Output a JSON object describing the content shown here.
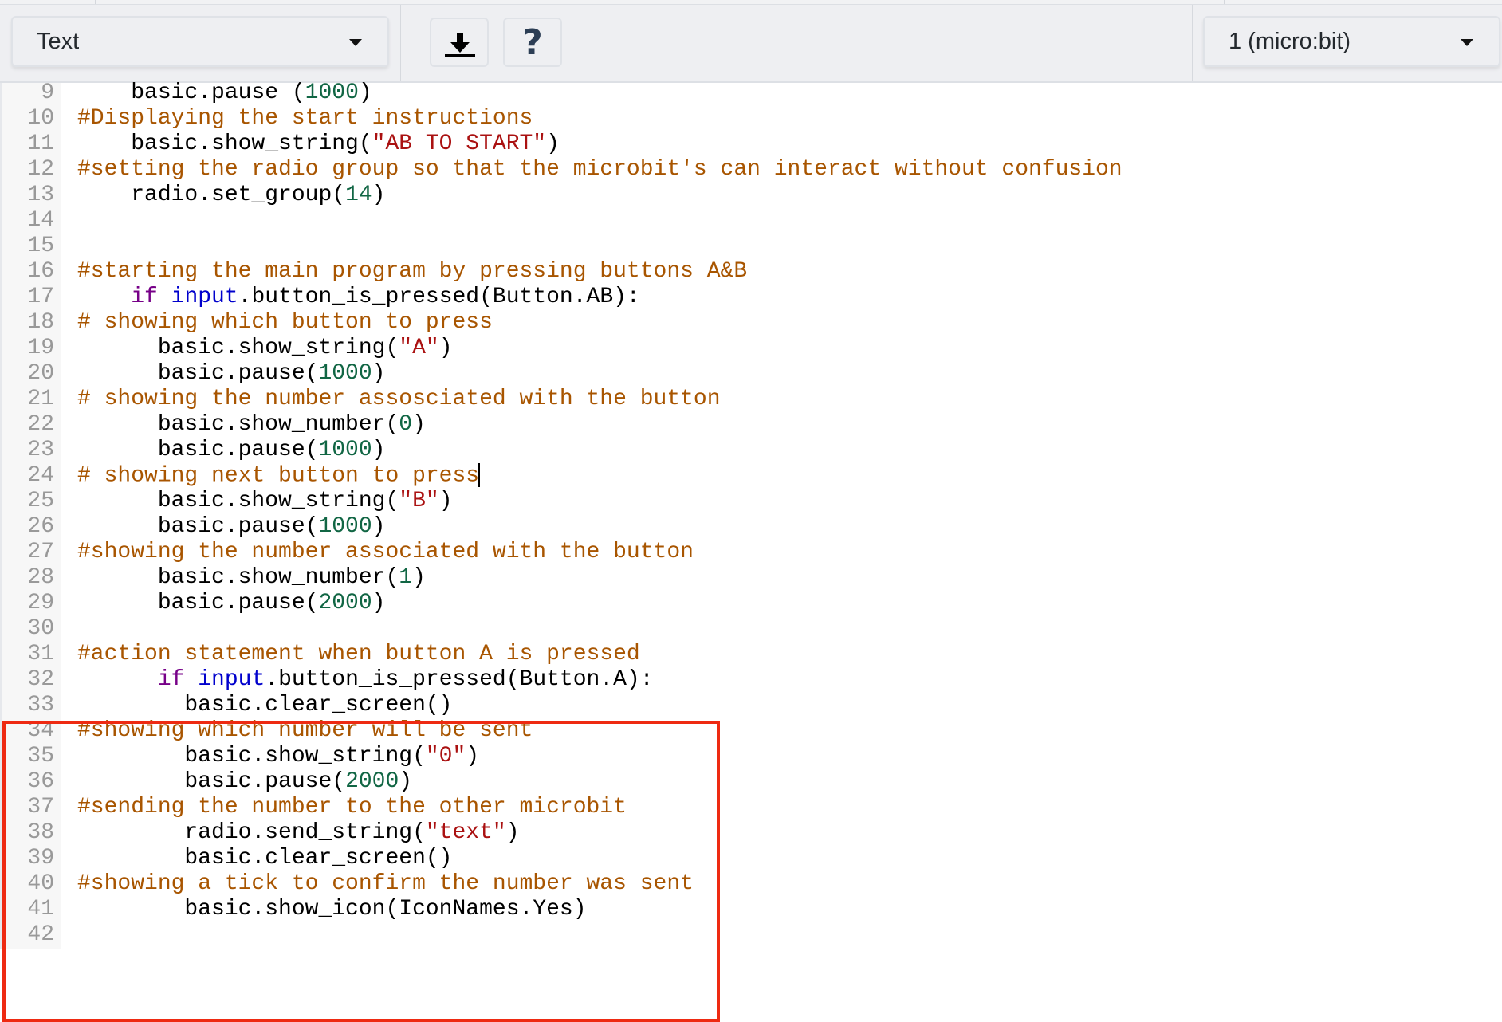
{
  "toolbar": {
    "language_select": {
      "value": "Text",
      "icon": "chevron-down-icon"
    },
    "download_button": {
      "icon": "download-icon",
      "label": "Download"
    },
    "help_button": {
      "icon": "help-icon",
      "glyph": "?"
    },
    "device_select": {
      "value": "1 (micro:bit)",
      "icon": "chevron-down-icon"
    }
  },
  "editor": {
    "cursor_line": 24,
    "highlight": {
      "from_line": 31,
      "to_line": 42,
      "color": "#ee2a12"
    },
    "lines": [
      {
        "n": "9",
        "tokens": [
          [
            "plain",
            "    basic.pause ("
          ],
          [
            "number",
            "1000"
          ],
          [
            "plain",
            ")"
          ]
        ]
      },
      {
        "n": "10",
        "tokens": [
          [
            "comment",
            "#Displaying the start instructions"
          ]
        ]
      },
      {
        "n": "11",
        "tokens": [
          [
            "plain",
            "    basic.show_string("
          ],
          [
            "string",
            "\"AB TO START\""
          ],
          [
            "plain",
            ")"
          ]
        ]
      },
      {
        "n": "12",
        "tokens": [
          [
            "comment",
            "#setting the radio group so that the microbit's can interact without confusion"
          ]
        ]
      },
      {
        "n": "13",
        "tokens": [
          [
            "plain",
            "    radio.set_group("
          ],
          [
            "number",
            "14"
          ],
          [
            "plain",
            ")"
          ]
        ]
      },
      {
        "n": "14",
        "tokens": []
      },
      {
        "n": "15",
        "tokens": []
      },
      {
        "n": "16",
        "tokens": [
          [
            "comment",
            "#starting the main program by pressing buttons A&B"
          ]
        ]
      },
      {
        "n": "17",
        "tokens": [
          [
            "plain",
            "    "
          ],
          [
            "keyword",
            "if"
          ],
          [
            "plain",
            " "
          ],
          [
            "builtin",
            "input"
          ],
          [
            "plain",
            ".button_is_pressed(Button.AB):"
          ]
        ]
      },
      {
        "n": "18",
        "tokens": [
          [
            "comment",
            "# showing which button to press"
          ]
        ]
      },
      {
        "n": "19",
        "tokens": [
          [
            "plain",
            "      basic.show_string("
          ],
          [
            "string",
            "\"A\""
          ],
          [
            "plain",
            ")"
          ]
        ]
      },
      {
        "n": "20",
        "tokens": [
          [
            "plain",
            "      basic.pause("
          ],
          [
            "number",
            "1000"
          ],
          [
            "plain",
            ")"
          ]
        ]
      },
      {
        "n": "21",
        "tokens": [
          [
            "comment",
            "# showing the number assosciated with the button"
          ]
        ]
      },
      {
        "n": "22",
        "tokens": [
          [
            "plain",
            "      basic.show_number("
          ],
          [
            "number",
            "0"
          ],
          [
            "plain",
            ")"
          ]
        ]
      },
      {
        "n": "23",
        "tokens": [
          [
            "plain",
            "      basic.pause("
          ],
          [
            "number",
            "1000"
          ],
          [
            "plain",
            ")"
          ]
        ]
      },
      {
        "n": "24",
        "tokens": [
          [
            "comment",
            "# showing next button to press"
          ]
        ],
        "cursor": true
      },
      {
        "n": "25",
        "tokens": [
          [
            "plain",
            "      basic.show_string("
          ],
          [
            "string",
            "\"B\""
          ],
          [
            "plain",
            ")"
          ]
        ]
      },
      {
        "n": "26",
        "tokens": [
          [
            "plain",
            "      basic.pause("
          ],
          [
            "number",
            "1000"
          ],
          [
            "plain",
            ")"
          ]
        ]
      },
      {
        "n": "27",
        "tokens": [
          [
            "comment",
            "#showing the number associated with the button"
          ]
        ]
      },
      {
        "n": "28",
        "tokens": [
          [
            "plain",
            "      basic.show_number("
          ],
          [
            "number",
            "1"
          ],
          [
            "plain",
            ")"
          ]
        ]
      },
      {
        "n": "29",
        "tokens": [
          [
            "plain",
            "      basic.pause("
          ],
          [
            "number",
            "2000"
          ],
          [
            "plain",
            ")"
          ]
        ]
      },
      {
        "n": "30",
        "tokens": []
      },
      {
        "n": "31",
        "tokens": [
          [
            "comment",
            "#action statement when button A is pressed"
          ]
        ]
      },
      {
        "n": "32",
        "tokens": [
          [
            "plain",
            "      "
          ],
          [
            "keyword",
            "if"
          ],
          [
            "plain",
            " "
          ],
          [
            "builtin",
            "input"
          ],
          [
            "plain",
            ".button_is_pressed(Button.A):"
          ]
        ]
      },
      {
        "n": "33",
        "tokens": [
          [
            "plain",
            "        basic.clear_screen()"
          ]
        ]
      },
      {
        "n": "34",
        "tokens": [
          [
            "comment",
            "#showing which number will be sent"
          ]
        ]
      },
      {
        "n": "35",
        "tokens": [
          [
            "plain",
            "        basic.show_string("
          ],
          [
            "string",
            "\"0\""
          ],
          [
            "plain",
            ")"
          ]
        ]
      },
      {
        "n": "36",
        "tokens": [
          [
            "plain",
            "        basic.pause("
          ],
          [
            "number",
            "2000"
          ],
          [
            "plain",
            ")"
          ]
        ]
      },
      {
        "n": "37",
        "tokens": [
          [
            "comment",
            "#sending the number to the other microbit"
          ]
        ]
      },
      {
        "n": "38",
        "tokens": [
          [
            "plain",
            "        radio.send_string("
          ],
          [
            "string",
            "\"text\""
          ],
          [
            "plain",
            ")"
          ]
        ]
      },
      {
        "n": "39",
        "tokens": [
          [
            "plain",
            "        basic.clear_screen()"
          ]
        ]
      },
      {
        "n": "40",
        "tokens": [
          [
            "comment",
            "#showing a tick to confirm the number was sent"
          ]
        ]
      },
      {
        "n": "41",
        "tokens": [
          [
            "plain",
            "        basic.show_icon(IconNames.Yes)"
          ]
        ]
      },
      {
        "n": "42",
        "tokens": []
      }
    ]
  }
}
